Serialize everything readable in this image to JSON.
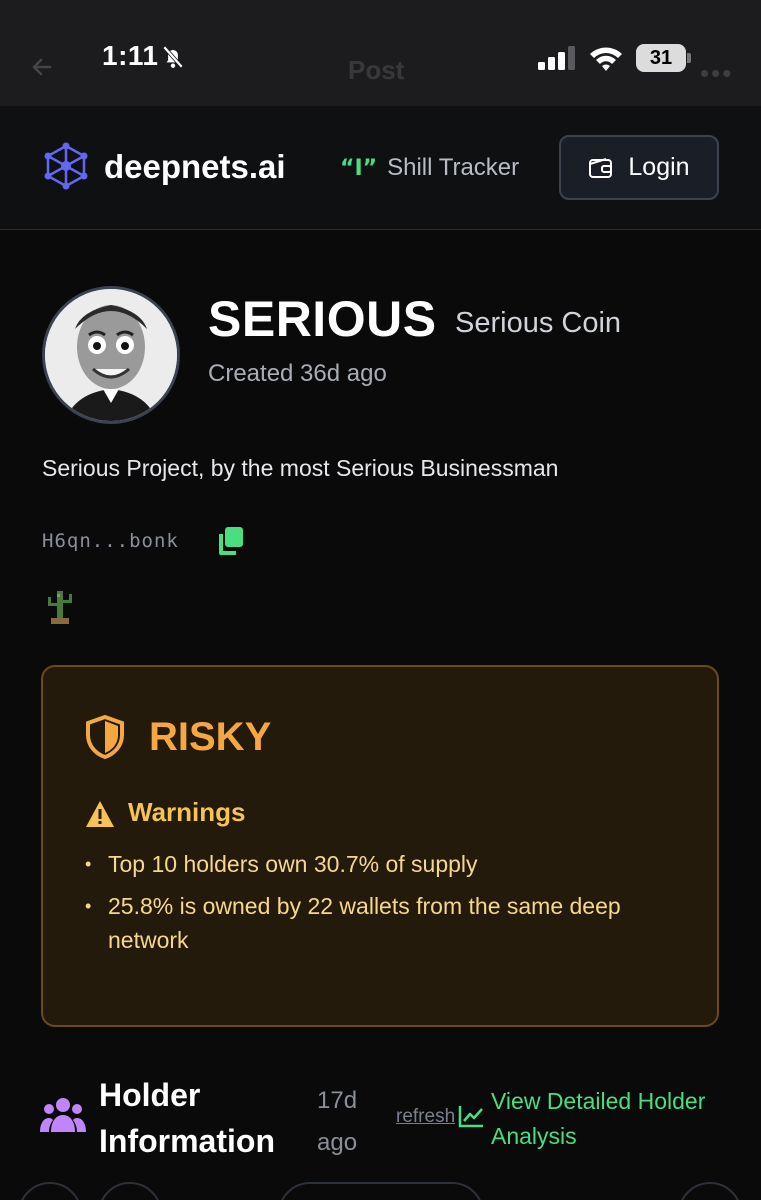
{
  "status_bar": {
    "time": "1:11",
    "battery": "31",
    "background_title": "Post"
  },
  "header": {
    "brand": "deepnets.ai",
    "shill_tracker": "Shill Tracker",
    "login": "Login"
  },
  "token": {
    "symbol": "SERIOUS",
    "name": "Serious Coin",
    "created": "Created 36d ago",
    "description": "Serious Project, by the most Serious Businessman",
    "address": "H6qn...bonk"
  },
  "risk": {
    "level": "RISKY",
    "warnings_title": "Warnings",
    "warnings": [
      "Top 10 holders own 30.7% of supply",
      "25.8% is owned by 22 wallets from the same deep network"
    ]
  },
  "holders": {
    "title": "Holder Information",
    "age": "17d ago",
    "refresh": "refresh",
    "view_detailed": "View Detailed Holder Analysis"
  },
  "colors": {
    "accent_green": "#4ade80",
    "risk_orange": "#f5a742",
    "warning_yellow": "#f6c454",
    "brand_purple": "#6366f1"
  }
}
